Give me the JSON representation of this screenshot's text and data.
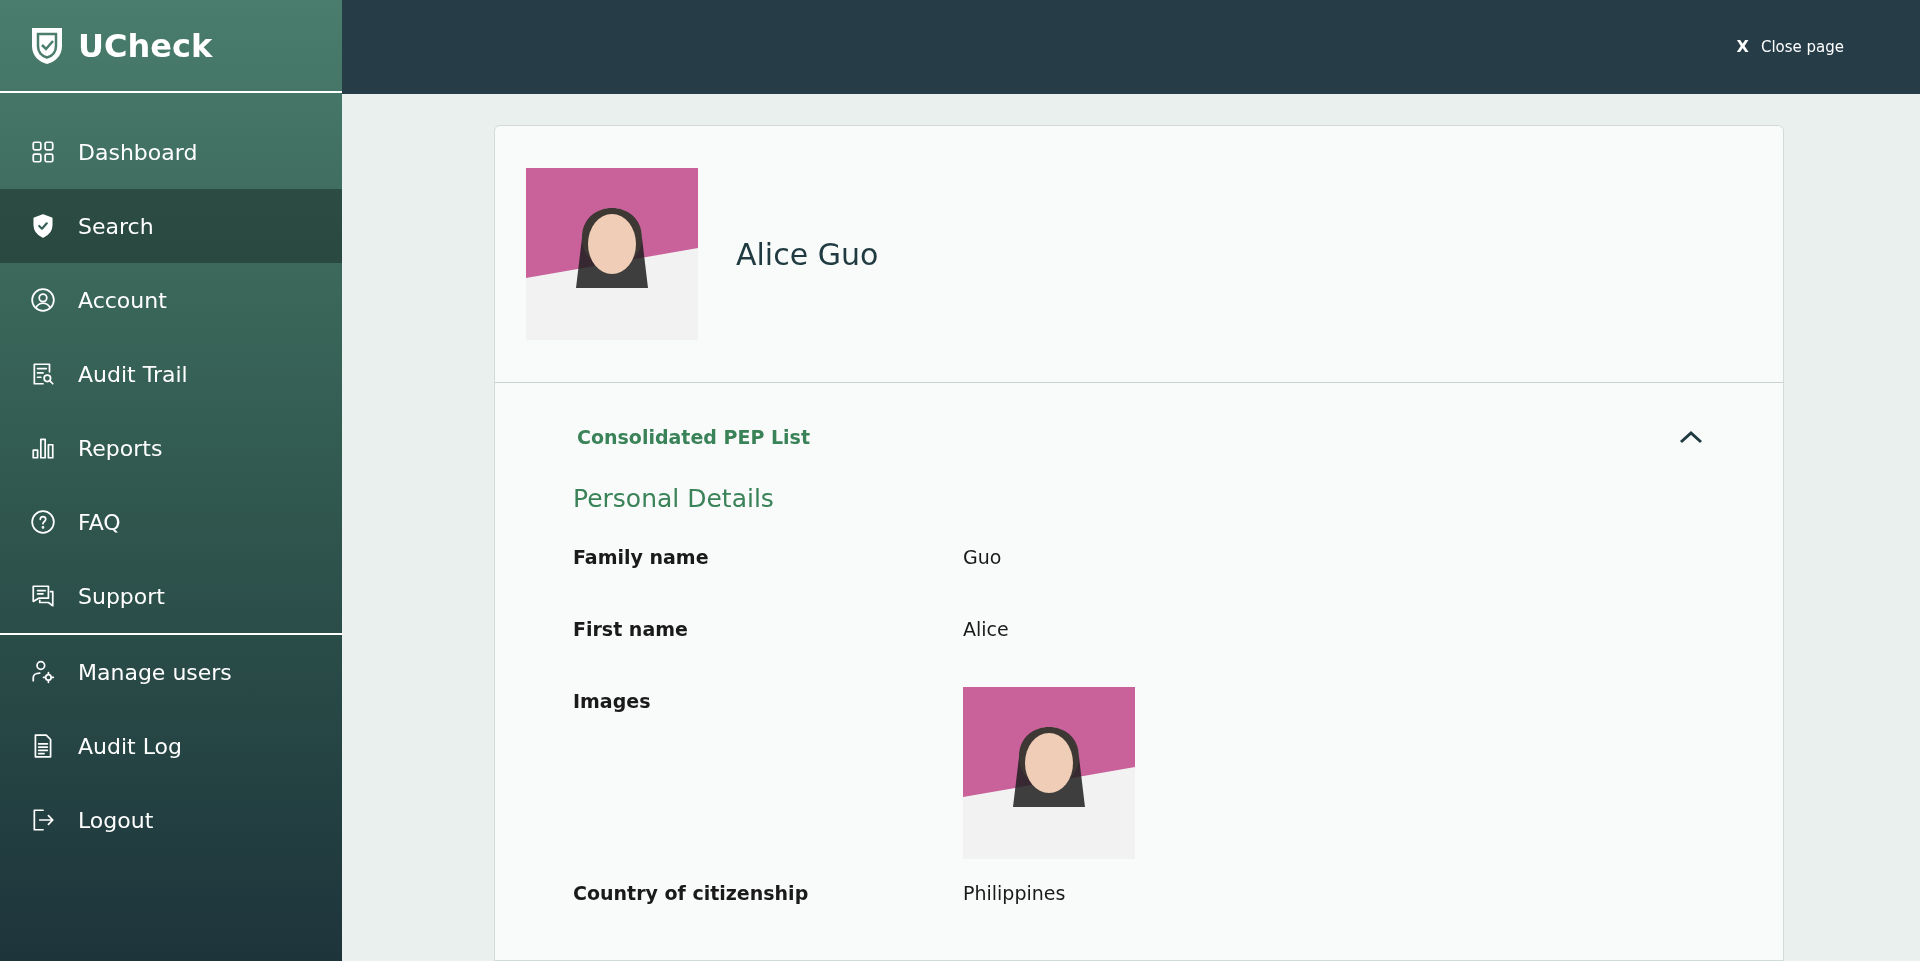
{
  "brand": {
    "name": "UCheck"
  },
  "sidebar": {
    "main_items": [
      {
        "label": "Dashboard",
        "selected": false
      },
      {
        "label": "Search",
        "selected": true
      },
      {
        "label": "Account",
        "selected": false
      },
      {
        "label": "Audit Trail",
        "selected": false
      },
      {
        "label": "Reports",
        "selected": false
      },
      {
        "label": "FAQ",
        "selected": false
      },
      {
        "label": "Support",
        "selected": false
      }
    ],
    "admin_items": [
      {
        "label": "Manage users",
        "selected": false
      },
      {
        "label": "Audit Log",
        "selected": false
      },
      {
        "label": "Logout",
        "selected": false
      }
    ]
  },
  "header": {
    "close_icon": "X",
    "close_label": "Close page"
  },
  "profile": {
    "name": "Alice Guo"
  },
  "section": {
    "title": "Consolidated PEP List",
    "expanded": true,
    "subtitle": "Personal Details",
    "fields": [
      {
        "kind": "text",
        "label": "Family name",
        "value": "Guo"
      },
      {
        "kind": "text",
        "label": "First name",
        "value": "Alice"
      },
      {
        "kind": "image",
        "label": "Images"
      },
      {
        "kind": "text",
        "label": "Country of citizenship",
        "value": "Philippines"
      }
    ]
  }
}
